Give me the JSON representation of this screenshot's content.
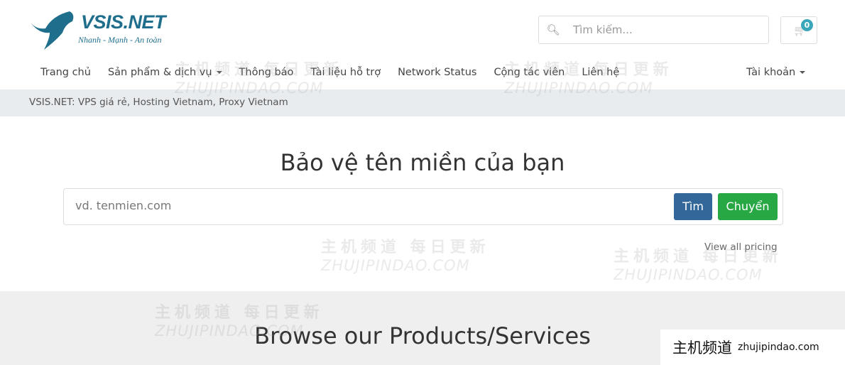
{
  "header": {
    "logo_text": "VSIS.NET",
    "logo_tagline": "Nhanh - Mạnh - An toàn",
    "search_placeholder": "Tìm kiếm...",
    "cart_count": "0"
  },
  "nav": {
    "items": [
      {
        "label": "Trang chủ"
      },
      {
        "label": "Sản phẩm & dịch vụ"
      },
      {
        "label": "Thông báo"
      },
      {
        "label": "Tài liệu hỗ trợ"
      },
      {
        "label": "Network Status"
      },
      {
        "label": "Cộng tác viên"
      },
      {
        "label": "Liên hệ"
      }
    ],
    "account": "Tài khoản"
  },
  "breadcrumb": "VSIS.NET: VPS giá rẻ, Hosting Vietnam, Proxy Vietnam",
  "domain": {
    "title": "Bảo vệ tên miền của bạn",
    "placeholder": "vd. tenmien.com",
    "search_button": "Tìm",
    "transfer_button": "Chuyển",
    "pricing_link": "View all pricing"
  },
  "products": {
    "title": "Browse our Products/Services"
  },
  "watermark": {
    "cn": "主机频道 每日更新",
    "en": "ZHUJIPINDAO.COM"
  },
  "site_badge": {
    "cn": "主机频道",
    "en": "zhujipindao.com"
  },
  "colors": {
    "brand": "#1f6e8c",
    "find": "#336699",
    "transfer": "#28a745",
    "badge": "#3aa6b9"
  }
}
